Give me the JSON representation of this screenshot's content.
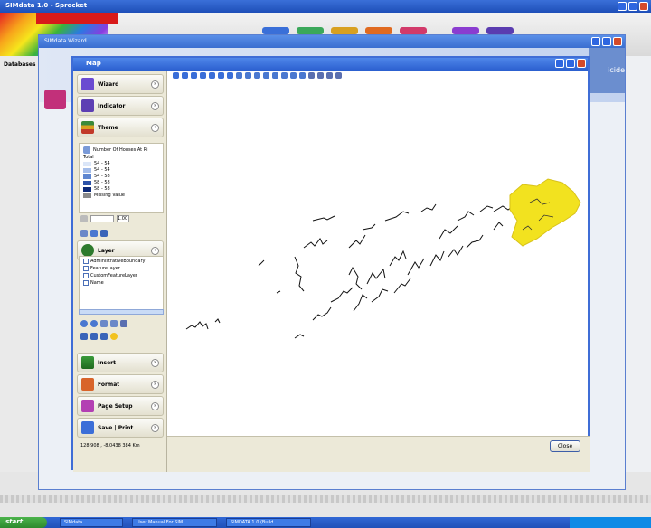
{
  "outer_title": "SIMdata 1.0 - Sprocket",
  "left_label": "Databases",
  "wizard_title": "SIMdata Wizard",
  "wizard_right_text": "icide",
  "map_title": "Map",
  "sidebar": {
    "panels": [
      {
        "label": "Wizard",
        "color": "#6a4bd1"
      },
      {
        "label": "Indicator",
        "color": "#5d3fb3"
      },
      {
        "label": "Theme",
        "color": "#3a8a3a"
      },
      {
        "label": "Layer",
        "color": "#2d7a2d"
      },
      {
        "label": "Insert",
        "color": "#3a9a3a"
      },
      {
        "label": "Format",
        "color": "#d8642a"
      },
      {
        "label": "Page Setup",
        "color": "#b33fb3"
      },
      {
        "label": "Save | Print",
        "color": "#3b6ed8"
      }
    ]
  },
  "legend": {
    "header": "Number Of Houses At Ri",
    "subheader": "Total",
    "items": [
      {
        "label": "54 - 54",
        "color": "#dbe6f8"
      },
      {
        "label": "54 - 54",
        "color": "#a4bdea"
      },
      {
        "label": "54 - 58",
        "color": "#5e86d0"
      },
      {
        "label": "58 - 58",
        "color": "#2c52a8"
      },
      {
        "label": "58 - 58",
        "color": "#0d2a78"
      },
      {
        "label": "Missing Value",
        "color": "#8a8a8a"
      }
    ],
    "line_width": "1.00"
  },
  "layers": [
    "AdministrativeBoundary",
    "FeatureLayer",
    "CustomFeatureLayer",
    "Name"
  ],
  "footer": {
    "coords": "128.908 , -8.0438  384 Km",
    "close_label": "Close"
  },
  "taskbar": {
    "start_label": "start",
    "items": [
      "SIMdata",
      "User Manual For SIM...",
      "SIMDATA 1.0 (Build..."
    ]
  },
  "colors": {
    "highlight_region": "#f2e21f"
  }
}
